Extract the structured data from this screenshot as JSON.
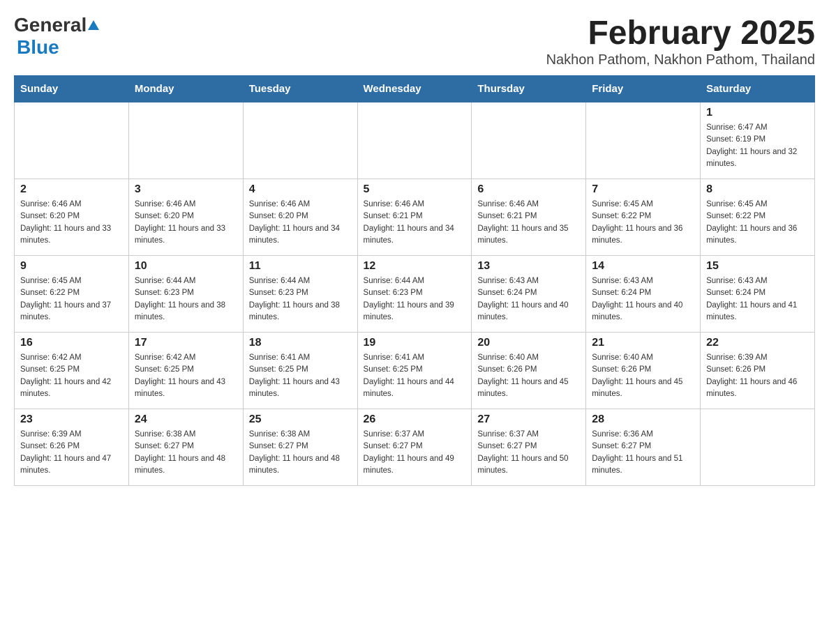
{
  "header": {
    "logo_general": "General",
    "logo_blue": "Blue",
    "title": "February 2025",
    "subtitle": "Nakhon Pathom, Nakhon Pathom, Thailand"
  },
  "calendar": {
    "days_of_week": [
      "Sunday",
      "Monday",
      "Tuesday",
      "Wednesday",
      "Thursday",
      "Friday",
      "Saturday"
    ],
    "weeks": [
      [
        {
          "day": "",
          "info": ""
        },
        {
          "day": "",
          "info": ""
        },
        {
          "day": "",
          "info": ""
        },
        {
          "day": "",
          "info": ""
        },
        {
          "day": "",
          "info": ""
        },
        {
          "day": "",
          "info": ""
        },
        {
          "day": "1",
          "info": "Sunrise: 6:47 AM\nSunset: 6:19 PM\nDaylight: 11 hours and 32 minutes."
        }
      ],
      [
        {
          "day": "2",
          "info": "Sunrise: 6:46 AM\nSunset: 6:20 PM\nDaylight: 11 hours and 33 minutes."
        },
        {
          "day": "3",
          "info": "Sunrise: 6:46 AM\nSunset: 6:20 PM\nDaylight: 11 hours and 33 minutes."
        },
        {
          "day": "4",
          "info": "Sunrise: 6:46 AM\nSunset: 6:20 PM\nDaylight: 11 hours and 34 minutes."
        },
        {
          "day": "5",
          "info": "Sunrise: 6:46 AM\nSunset: 6:21 PM\nDaylight: 11 hours and 34 minutes."
        },
        {
          "day": "6",
          "info": "Sunrise: 6:46 AM\nSunset: 6:21 PM\nDaylight: 11 hours and 35 minutes."
        },
        {
          "day": "7",
          "info": "Sunrise: 6:45 AM\nSunset: 6:22 PM\nDaylight: 11 hours and 36 minutes."
        },
        {
          "day": "8",
          "info": "Sunrise: 6:45 AM\nSunset: 6:22 PM\nDaylight: 11 hours and 36 minutes."
        }
      ],
      [
        {
          "day": "9",
          "info": "Sunrise: 6:45 AM\nSunset: 6:22 PM\nDaylight: 11 hours and 37 minutes."
        },
        {
          "day": "10",
          "info": "Sunrise: 6:44 AM\nSunset: 6:23 PM\nDaylight: 11 hours and 38 minutes."
        },
        {
          "day": "11",
          "info": "Sunrise: 6:44 AM\nSunset: 6:23 PM\nDaylight: 11 hours and 38 minutes."
        },
        {
          "day": "12",
          "info": "Sunrise: 6:44 AM\nSunset: 6:23 PM\nDaylight: 11 hours and 39 minutes."
        },
        {
          "day": "13",
          "info": "Sunrise: 6:43 AM\nSunset: 6:24 PM\nDaylight: 11 hours and 40 minutes."
        },
        {
          "day": "14",
          "info": "Sunrise: 6:43 AM\nSunset: 6:24 PM\nDaylight: 11 hours and 40 minutes."
        },
        {
          "day": "15",
          "info": "Sunrise: 6:43 AM\nSunset: 6:24 PM\nDaylight: 11 hours and 41 minutes."
        }
      ],
      [
        {
          "day": "16",
          "info": "Sunrise: 6:42 AM\nSunset: 6:25 PM\nDaylight: 11 hours and 42 minutes."
        },
        {
          "day": "17",
          "info": "Sunrise: 6:42 AM\nSunset: 6:25 PM\nDaylight: 11 hours and 43 minutes."
        },
        {
          "day": "18",
          "info": "Sunrise: 6:41 AM\nSunset: 6:25 PM\nDaylight: 11 hours and 43 minutes."
        },
        {
          "day": "19",
          "info": "Sunrise: 6:41 AM\nSunset: 6:25 PM\nDaylight: 11 hours and 44 minutes."
        },
        {
          "day": "20",
          "info": "Sunrise: 6:40 AM\nSunset: 6:26 PM\nDaylight: 11 hours and 45 minutes."
        },
        {
          "day": "21",
          "info": "Sunrise: 6:40 AM\nSunset: 6:26 PM\nDaylight: 11 hours and 45 minutes."
        },
        {
          "day": "22",
          "info": "Sunrise: 6:39 AM\nSunset: 6:26 PM\nDaylight: 11 hours and 46 minutes."
        }
      ],
      [
        {
          "day": "23",
          "info": "Sunrise: 6:39 AM\nSunset: 6:26 PM\nDaylight: 11 hours and 47 minutes."
        },
        {
          "day": "24",
          "info": "Sunrise: 6:38 AM\nSunset: 6:27 PM\nDaylight: 11 hours and 48 minutes."
        },
        {
          "day": "25",
          "info": "Sunrise: 6:38 AM\nSunset: 6:27 PM\nDaylight: 11 hours and 48 minutes."
        },
        {
          "day": "26",
          "info": "Sunrise: 6:37 AM\nSunset: 6:27 PM\nDaylight: 11 hours and 49 minutes."
        },
        {
          "day": "27",
          "info": "Sunrise: 6:37 AM\nSunset: 6:27 PM\nDaylight: 11 hours and 50 minutes."
        },
        {
          "day": "28",
          "info": "Sunrise: 6:36 AM\nSunset: 6:27 PM\nDaylight: 11 hours and 51 minutes."
        },
        {
          "day": "",
          "info": ""
        }
      ]
    ]
  }
}
